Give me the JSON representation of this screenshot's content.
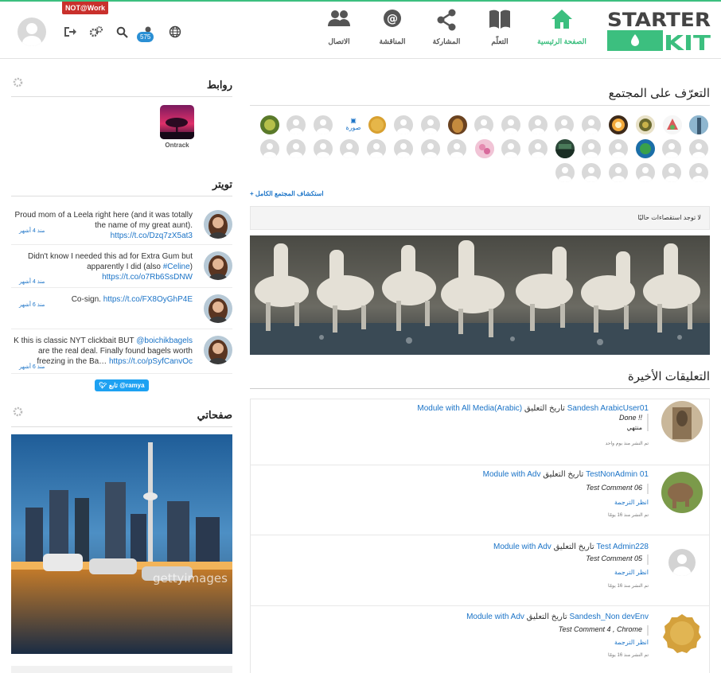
{
  "header": {
    "logo_top": "STARTER",
    "logo_bottom": "KIT",
    "notwork_label": "NOT@Work",
    "notification_count": "575",
    "nav": [
      {
        "label": "الصفحة الرئيسية",
        "icon": "home-icon"
      },
      {
        "label": "التعلّم",
        "icon": "book-icon"
      },
      {
        "label": "المشاركة",
        "icon": "share-icon"
      },
      {
        "label": "المناقشة",
        "icon": "at-icon"
      },
      {
        "label": "الاتصال",
        "icon": "people-icon"
      }
    ]
  },
  "sidebar": {
    "links_title": "روابط",
    "link_item_label": "Ontrack",
    "twitter_title": "تويتر",
    "tweets": [
      {
        "text_plain": "Proud mom of a Leela right here (and it was totally the name of my great aunt). ",
        "link": "https://t.co/Dzq7zX5at3",
        "age": "منذ 4 أشهر"
      },
      {
        "text_plain": "Didn't know I needed this ad for Extra Gum but apparently I did (also ",
        "hashtag": "#Celine",
        "text_tail": ") ",
        "link": "https://t.co/o7Rb6SsDNW",
        "age": "منذ 4 أشهر"
      },
      {
        "text_plain": "Co-sign. ",
        "link": "https://t.co/FX8OyGhP4E",
        "age": "منذ 6 أشهر"
      },
      {
        "text_plain": "K this is classic NYT clickbait BUT ",
        "mention": "@boichikbagels",
        "text_tail": " are the real deal. Finally found bagels worth freezing in the Ba… ",
        "link": "https://t.co/pSyfCanvOc",
        "age": "منذ 6 أشهر"
      }
    ],
    "follow_label": "تابع @ramya",
    "pages_title": "صفحاتي"
  },
  "main": {
    "community_title": "التعرّف على المجتمع",
    "broken_image_alt": "صورة",
    "explore_link": "+ استكشاف المجتمع الكامل",
    "poll_text": "لا توجد استقصاءات حاليًا",
    "comments_title": "التعليقات الأخيرة",
    "comments": [
      {
        "user": "Sandesh ArabicUser01",
        "verb": "تاريخ التعليق",
        "module": "Module with All Media(Arabic)",
        "body": "Done !!",
        "body2": "منتهي",
        "translate": "",
        "time": "تم النشر منذ يوم واحد"
      },
      {
        "user": "TestNonAdmin 01",
        "verb": "تاريخ التعليق",
        "module": "Module with Adv",
        "body": "Test Comment 06",
        "body2": "",
        "translate": "انظر الترجمة",
        "time": "تم النشر منذ 16 يومًا"
      },
      {
        "user": "Test Admin228",
        "verb": "تاريخ التعليق",
        "module": "Module with Adv",
        "body": "Test Comment 05",
        "body2": "",
        "translate": "انظر الترجمة",
        "time": "تم النشر منذ 16 يومًا"
      },
      {
        "user": "Sandesh_Non devEnv",
        "verb": "تاريخ التعليق",
        "module": "Module with Adv",
        "body": "Test Comment 4 , Chrome",
        "body2": "",
        "translate": "انظر الترجمة",
        "time": "تم النشر منذ 16 يومًا"
      }
    ]
  },
  "colors": {
    "accent": "#3cbf7f",
    "link": "#1a73c7",
    "danger": "#c9302c"
  }
}
